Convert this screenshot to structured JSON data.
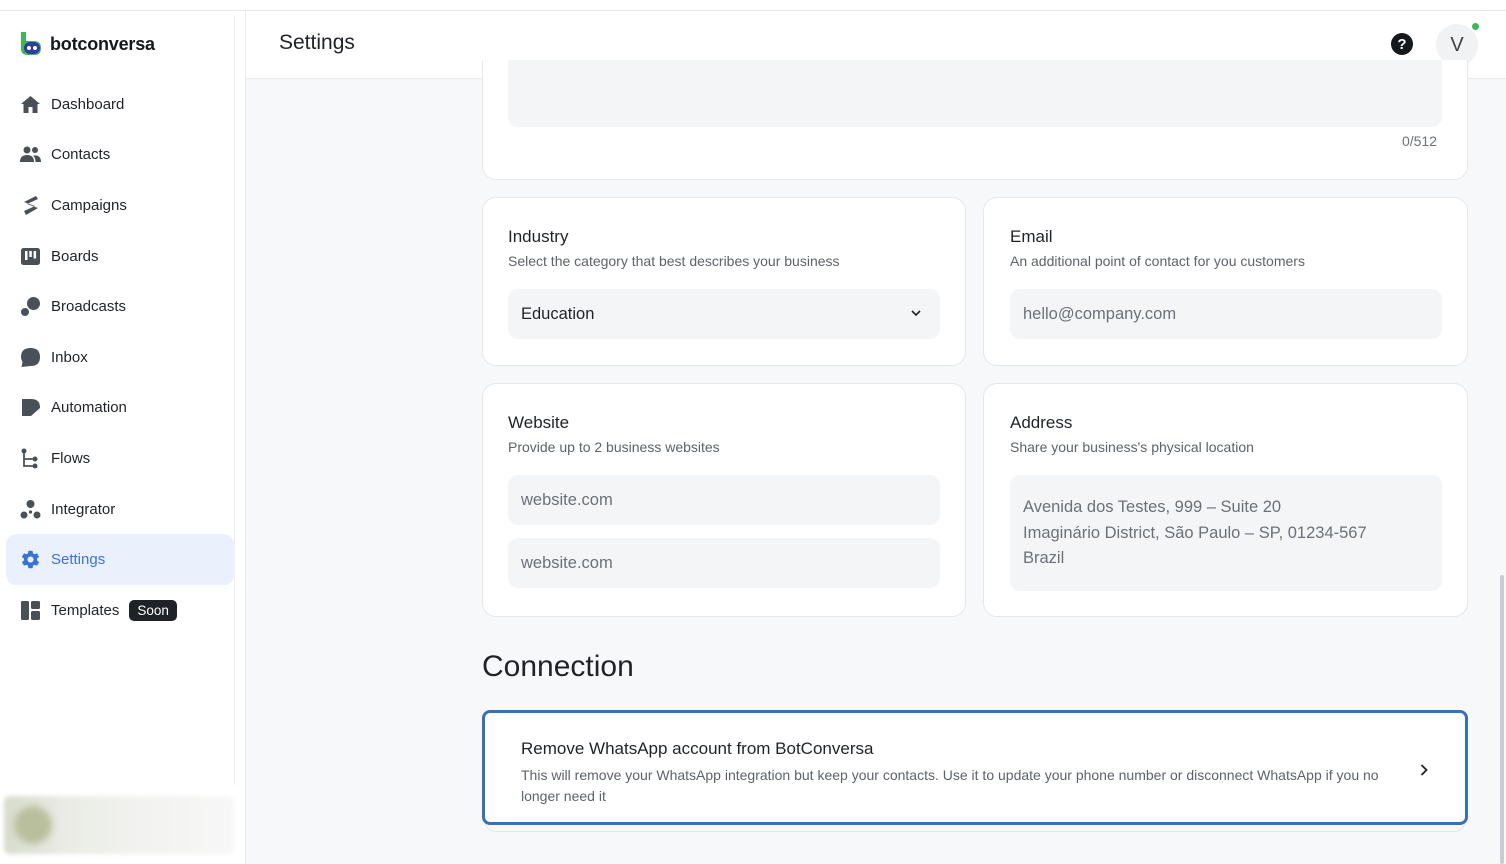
{
  "brand": {
    "name": "botconversa"
  },
  "header": {
    "title": "Settings",
    "help_label": "?",
    "avatar_initial": "V"
  },
  "sidebar": {
    "items": [
      {
        "label": "Dashboard",
        "icon": "home-icon"
      },
      {
        "label": "Contacts",
        "icon": "users-icon"
      },
      {
        "label": "Campaigns",
        "icon": "campaign-icon"
      },
      {
        "label": "Boards",
        "icon": "board-icon"
      },
      {
        "label": "Broadcasts",
        "icon": "broadcast-icon"
      },
      {
        "label": "Inbox",
        "icon": "chat-bubble-icon"
      },
      {
        "label": "Automation",
        "icon": "automation-icon"
      },
      {
        "label": "Flows",
        "icon": "flow-icon"
      },
      {
        "label": "Integrator",
        "icon": "integrator-icon"
      },
      {
        "label": "Settings",
        "icon": "gear-icon",
        "active": true
      },
      {
        "label": "Templates",
        "icon": "templates-icon",
        "badge": "Soon"
      }
    ]
  },
  "description": {
    "counter": "0/512"
  },
  "industry": {
    "title": "Industry",
    "subtitle": "Select the category that best describes your business",
    "selected": "Education"
  },
  "email": {
    "title": "Email",
    "subtitle": "An additional point of contact for you customers",
    "placeholder": "hello@company.com"
  },
  "website": {
    "title": "Website",
    "subtitle": "Provide up to 2 business websites",
    "placeholder_1": "website.com",
    "placeholder_2": "website.com"
  },
  "address": {
    "title": "Address",
    "subtitle": "Share your business's physical location",
    "line1": "Avenida dos Testes, 999 – Suite 20",
    "line2": "Imaginário District, São Paulo – SP, 01234-567",
    "line3": "Brazil"
  },
  "connection": {
    "section_title": "Connection",
    "remove_title": "Remove WhatsApp account from BotConversa",
    "remove_desc": "This will remove your WhatsApp integration but keep your contacts. Use it to update your phone number or disconnect WhatsApp if you no longer need it"
  },
  "colors": {
    "accent": "#3a73d8",
    "active_bg": "#eaf1fd",
    "focus_border": "#3a6fb9",
    "online": "#3fb65a"
  }
}
